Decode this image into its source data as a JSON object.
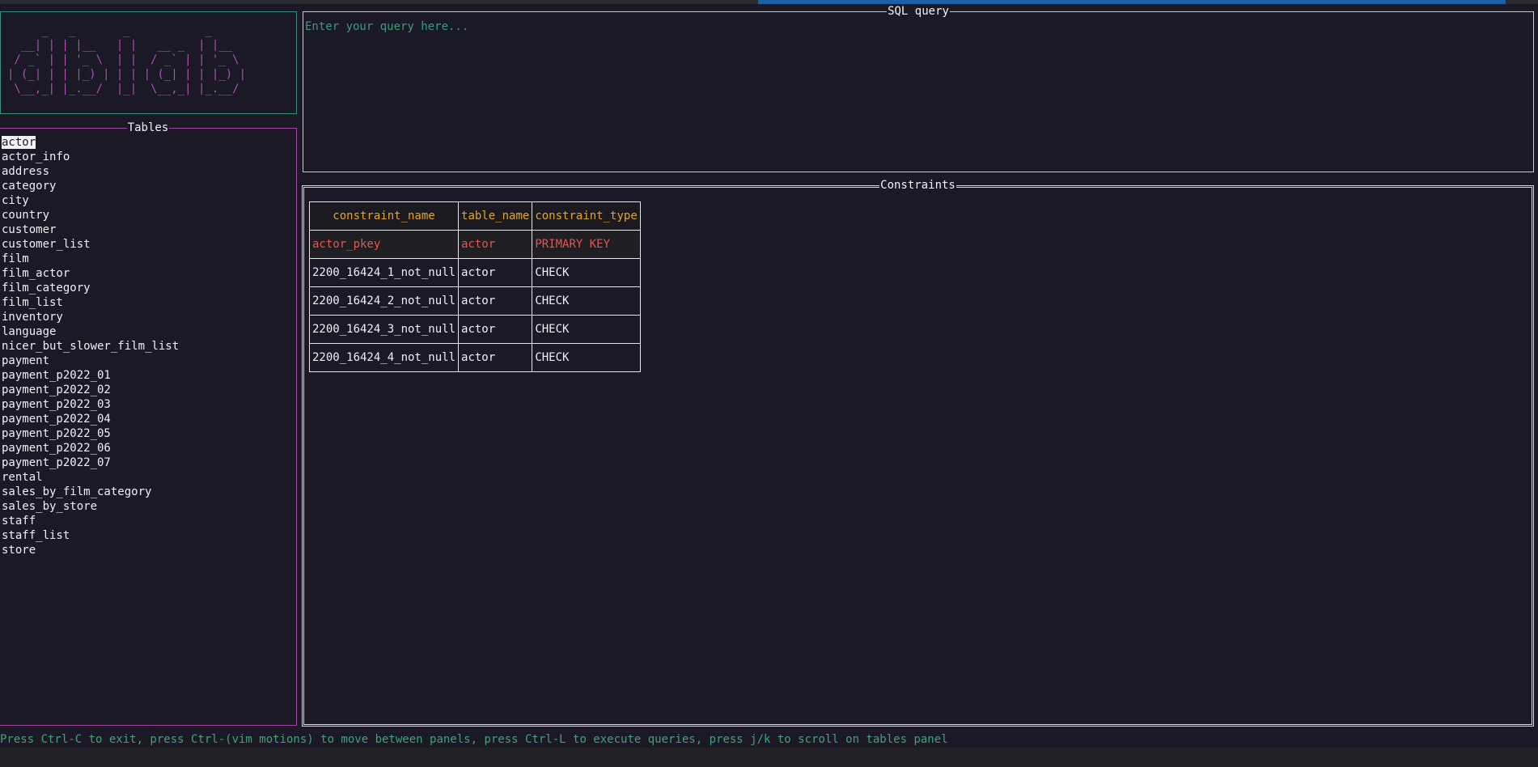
{
  "logo": {
    "ascii": "     _   _       _           _\n  __| | | |__   | |   __ _  | |__\n / _` | | '_ \\  | |  / _` | | '_ \\\n| (_| | | |_) | | | | (_| | | |_) |\n \\__,_| |_.__/  |_|  \\__,_| |_.__/"
  },
  "tables_panel": {
    "title": "Tables",
    "items": [
      "actor",
      "actor_info",
      "address",
      "category",
      "city",
      "country",
      "customer",
      "customer_list",
      "film",
      "film_actor",
      "film_category",
      "film_list",
      "inventory",
      "language",
      "nicer_but_slower_film_list",
      "payment",
      "payment_p2022_01",
      "payment_p2022_02",
      "payment_p2022_03",
      "payment_p2022_04",
      "payment_p2022_05",
      "payment_p2022_06",
      "payment_p2022_07",
      "rental",
      "sales_by_film_category",
      "sales_by_store",
      "staff",
      "staff_list",
      "store"
    ],
    "selected_index": 0
  },
  "sql_panel": {
    "title": "SQL query",
    "placeholder": "Enter your query here...",
    "value": ""
  },
  "constraints_panel": {
    "title": "Constraints",
    "headers": [
      "constraint_name",
      "table_name",
      "constraint_type"
    ],
    "rows": [
      [
        "actor_pkey",
        "actor",
        "PRIMARY KEY"
      ],
      [
        "2200_16424_1_not_null",
        "actor",
        "CHECK"
      ],
      [
        "2200_16424_2_not_null",
        "actor",
        "CHECK"
      ],
      [
        "2200_16424_3_not_null",
        "actor",
        "CHECK"
      ],
      [
        "2200_16424_4_not_null",
        "actor",
        "CHECK"
      ]
    ],
    "highlighted_row": 0
  },
  "status_bar": {
    "text": "Press Ctrl-C to exit, press Ctrl-(vim motions) to move between panels, press Ctrl-L to execute queries, press j/k to scroll on tables panel"
  },
  "colors": {
    "background": "#1b1926",
    "logo_border": "#3c8f80",
    "logo_text": "#b04fb4",
    "tables_border": "#a247a7",
    "header_text": "#e3a42f",
    "highlight_row_text": "#e0584d",
    "status_text": "#3fa27b",
    "accent_bar": "#1f5fa8"
  }
}
